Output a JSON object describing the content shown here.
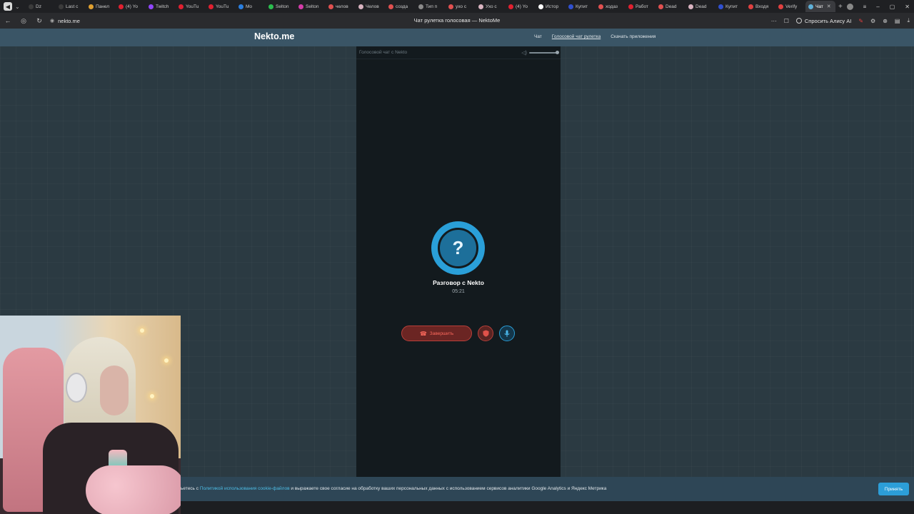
{
  "browser": {
    "tabs": [
      {
        "label": "Dz",
        "color": "#3b3b3b"
      },
      {
        "label": "Last c",
        "color": "#3b3b3b"
      },
      {
        "label": "Панел",
        "color": "#e0a030"
      },
      {
        "label": "(4) Yo",
        "color": "#e02030"
      },
      {
        "label": "Twitch",
        "color": "#9146ff"
      },
      {
        "label": "YouTu",
        "color": "#e02030"
      },
      {
        "label": "YouTu",
        "color": "#e02030"
      },
      {
        "label": "Mo",
        "color": "#2a7fe0"
      },
      {
        "label": "Selton",
        "color": "#2bbd4e"
      },
      {
        "label": "Selton",
        "color": "#d43ca8"
      },
      {
        "label": "челов",
        "color": "#e05050"
      },
      {
        "label": "Челов",
        "color": "#d9b3c0"
      },
      {
        "label": "созда",
        "color": "#e05050"
      },
      {
        "label": "Тип п",
        "color": "#8a8a8a"
      },
      {
        "label": "ухо с",
        "color": "#e05050"
      },
      {
        "label": "Ухо с",
        "color": "#d9b3c0"
      },
      {
        "label": "(4) Yo",
        "color": "#e02030"
      },
      {
        "label": "Истор",
        "color": "#ffffff"
      },
      {
        "label": "Купит",
        "color": "#3050d0"
      },
      {
        "label": "ходаз",
        "color": "#e05050"
      },
      {
        "label": "Работ",
        "color": "#e02030"
      },
      {
        "label": "Dead",
        "color": "#e05050"
      },
      {
        "label": "Dead",
        "color": "#d9b3c0"
      },
      {
        "label": "Купит",
        "color": "#3050d0"
      },
      {
        "label": "Входя",
        "color": "#e04040"
      },
      {
        "label": "Verify",
        "color": "#e04040"
      },
      {
        "label": "Чат",
        "color": "#5fb0d8"
      }
    ],
    "url": "nekto.me",
    "page_title": "Чат рулетка голосовая — NektoMe",
    "alice_label": "Спросить Алису AI"
  },
  "site": {
    "logo": "Nekto.me",
    "nav": [
      {
        "label": "Чат",
        "current": false
      },
      {
        "label": "Голосовой чат рулетка",
        "current": true
      },
      {
        "label": "Скачать приложения",
        "current": false
      }
    ]
  },
  "call": {
    "panel_title": "Голосовой чат с Nekto",
    "avatar_symbol": "?",
    "peer_name": "Разговор с Nekto",
    "timer": "05:21",
    "end_label": "Завершить",
    "volume_level": 1.0
  },
  "cookie": {
    "text_before": "ьетесь с ",
    "link_text": "Политикой использования cookie-файлов",
    "text_after": " и выражаете свое согласие на обработку ваших персональных данных с использованием сервисов аналитики Google Analytics и Яндекс Метрика",
    "accept_label": "Принять"
  },
  "colors": {
    "accent": "#2a9fd8",
    "danger": "#b8403a",
    "header": "#3a5566",
    "panel": "#131a1e"
  }
}
